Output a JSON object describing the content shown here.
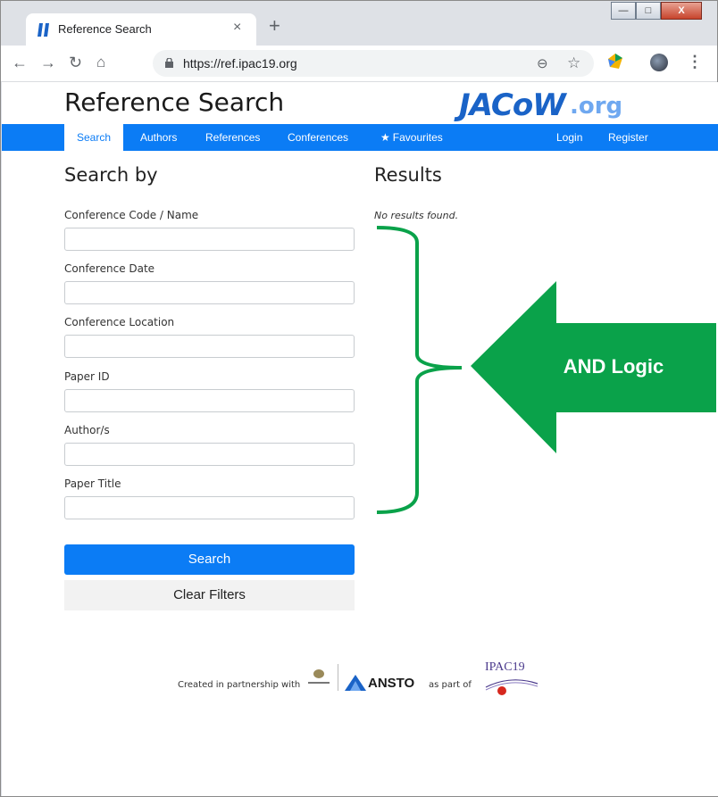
{
  "browser": {
    "tab_title": "Reference Search",
    "tab_close": "×",
    "new_tab": "+",
    "url": "https://ref.ipac19.org",
    "win_minimize": "—",
    "win_maximize": "□",
    "win_close": "X",
    "icons": [
      "back-icon",
      "forward-icon",
      "reload-icon",
      "home-icon",
      "lock-icon",
      "zoom-icon",
      "star-icon",
      "extension-icon",
      "avatar",
      "menu-icon"
    ]
  },
  "header": {
    "title": "Reference Search",
    "logo_main": "JACoW",
    "logo_suffix": ".org"
  },
  "nav": {
    "items": [
      {
        "label": "Search",
        "active": true
      },
      {
        "label": "Authors"
      },
      {
        "label": "References"
      },
      {
        "label": "Conferences"
      },
      {
        "label": "Favourites",
        "icon": "star-icon"
      }
    ],
    "right": [
      {
        "label": "Login"
      },
      {
        "label": "Register"
      }
    ]
  },
  "search": {
    "heading": "Search by",
    "fields": [
      {
        "label": "Conference Code / Name",
        "value": ""
      },
      {
        "label": "Conference Date",
        "value": ""
      },
      {
        "label": "Conference Location",
        "value": ""
      },
      {
        "label": "Paper ID",
        "value": ""
      },
      {
        "label": "Author/s",
        "value": ""
      },
      {
        "label": "Paper Title",
        "value": ""
      }
    ],
    "search_button": "Search",
    "clear_button": "Clear Filters"
  },
  "results": {
    "heading": "Results",
    "empty_text": "No results found."
  },
  "annotation": {
    "label": "AND Logic",
    "color": "#0aa24a"
  },
  "footer": {
    "created_text": "Created in partnership with",
    "ansto": "ANSTO",
    "as_part_of": "as part of",
    "ipac": "IPAC19"
  }
}
